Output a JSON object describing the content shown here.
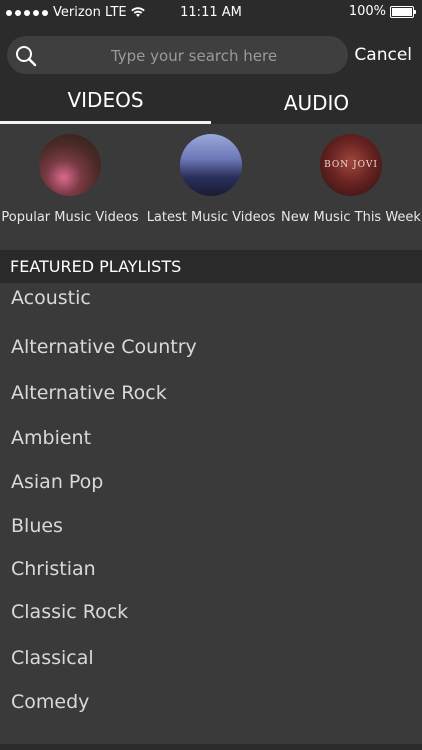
{
  "status_bar": {
    "carrier": "Verizon LTE",
    "time": "11:11 AM",
    "battery": "100%"
  },
  "search": {
    "placeholder": "Type your search here",
    "cancel_label": "Cancel"
  },
  "tabs": [
    {
      "label": "VIDEOS",
      "selected": true
    },
    {
      "label": "AUDIO",
      "selected": false
    }
  ],
  "categories": [
    {
      "label": "Popular Music Videos",
      "icon": "popular-thumbnail"
    },
    {
      "label": "Latest Music Videos",
      "icon": "latest-thumbnail"
    },
    {
      "label": "New Music This Week",
      "icon": "new-music-thumbnail",
      "thumb_text": "BON JOVI"
    }
  ],
  "featured": {
    "title": "FEATURED PLAYLISTS",
    "items": [
      "Acoustic",
      "Alternative Country",
      "Alternative Rock",
      "Ambient",
      "Asian Pop",
      "Blues",
      "Christian",
      "Classic Rock",
      "Classical",
      "Comedy"
    ]
  }
}
